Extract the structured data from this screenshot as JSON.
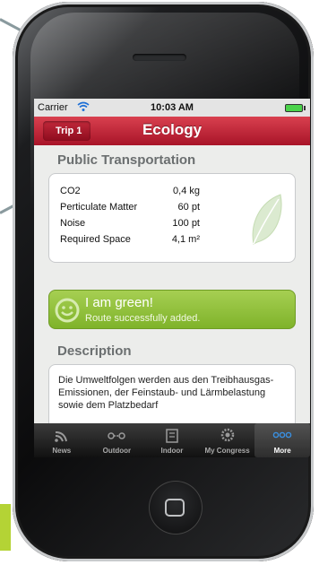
{
  "status_bar": {
    "carrier": "Carrier",
    "time": "10:03 AM"
  },
  "nav_bar": {
    "back_label": "Trip 1",
    "title": "Ecology"
  },
  "transport_section": {
    "header": "Public Transportation",
    "metrics": [
      {
        "label": "CO2",
        "value": "0,4 kg"
      },
      {
        "label": "Perticulate Matter",
        "value": "60 pt"
      },
      {
        "label": "Noise",
        "value": "100 pt"
      },
      {
        "label": "Required Space",
        "value": "4,1 m²"
      }
    ]
  },
  "success_banner": {
    "title": "I am green!",
    "subtitle": "Route successfully added."
  },
  "description": {
    "header": "Description",
    "text": "Die Umweltfolgen werden aus den Treibhausgas-Emissionen, der Feinstaub- und Lärmbelastung sowie dem Platzbedarf"
  },
  "tab_bar": {
    "tabs": [
      {
        "label": "News",
        "icon": "rss-icon"
      },
      {
        "label": "Outdoor",
        "icon": "route-icon"
      },
      {
        "label": "Indoor",
        "icon": "building-icon"
      },
      {
        "label": "My Congress",
        "icon": "gear-icon"
      },
      {
        "label": "More",
        "icon": "more-icon",
        "active": true
      }
    ]
  },
  "colors": {
    "nav_red": "#b01e32",
    "success_green": "#8dbf3a",
    "accent_lime": "#b4d335"
  }
}
